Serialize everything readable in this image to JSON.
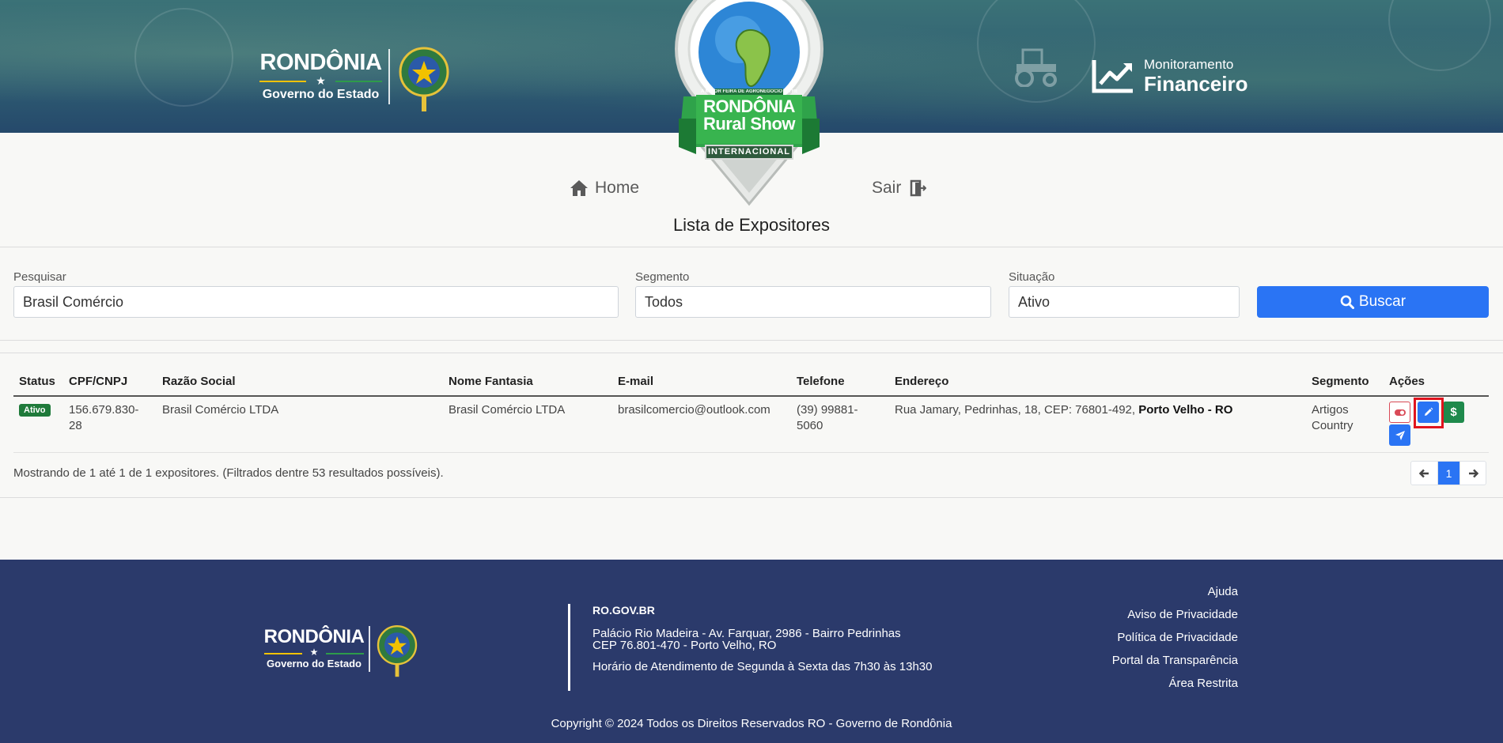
{
  "header": {
    "gov_logo": {
      "title": "RONDÔNIA",
      "star": "★",
      "subtitle": "Governo do Estado"
    },
    "event_logo": {
      "tagline": "A MAIOR FEIRA DE AGRONEGÓCIO DA REGIÃO NORTE",
      "name_line1": "RONDÔNIA",
      "name_line2": "Rural Show",
      "edition": "INTERNACIONAL"
    },
    "monitor": {
      "small": "Monitoramento",
      "big": "Financeiro"
    }
  },
  "nav": {
    "home_label": "Home",
    "exit_label": "Sair"
  },
  "page_title": "Lista de Expositores",
  "filters": {
    "search": {
      "label": "Pesquisar",
      "value": "Brasil Comércio"
    },
    "segment": {
      "label": "Segmento",
      "value": "Todos"
    },
    "situation": {
      "label": "Situação",
      "value": "Ativo"
    },
    "buscar_label": "Buscar"
  },
  "table": {
    "headers": [
      "Status",
      "CPF/CNPJ",
      "Razão Social",
      "Nome Fantasia",
      "E-mail",
      "Telefone",
      "Endereço",
      "Segmento",
      "Ações"
    ],
    "rows": [
      {
        "status": "Ativo",
        "cpf_cnpj": "156.679.830-28",
        "razao_social": "Brasil Comércio LTDA",
        "nome_fantasia": "Brasil Comércio LTDA",
        "email": "brasilcomercio@outlook.com",
        "telefone": "(39) 99881-5060",
        "endereco": "Rua Jamary, Pedrinhas, 18, CEP: 76801-492,",
        "cidade": "Porto Velho - RO",
        "segmento": "Artigos Country",
        "actions": {
          "money_symbol": "$"
        }
      }
    ]
  },
  "summary": "Mostrando de 1 até 1 de 1 expositores. (Filtrados dentre 53 resultados possíveis).",
  "pagination": {
    "current": "1"
  },
  "footer": {
    "site": "RO.GOV.BR",
    "address_line1": "Palácio Rio Madeira - Av. Farquar, 2986 - Bairro Pedrinhas",
    "address_line2": "CEP 76.801-470 - Porto Velho, RO",
    "hours": "Horário de Atendimento de Segunda à Sexta das 7h30 às 13h30",
    "links": [
      "Ajuda",
      "Aviso de Privacidade",
      "Política de Privacidade",
      "Portal da Transparência",
      "Área Restrita"
    ],
    "copyright": "Copyright © 2024 Todos os Direitos Reservados RO - Governo de Rondônia"
  },
  "colors": {
    "primary": "#2a74f4",
    "success": "#1f7a3a",
    "danger": "#d94a57",
    "footer_bg": "#2b3a6b",
    "banner": "#2f5d72"
  }
}
